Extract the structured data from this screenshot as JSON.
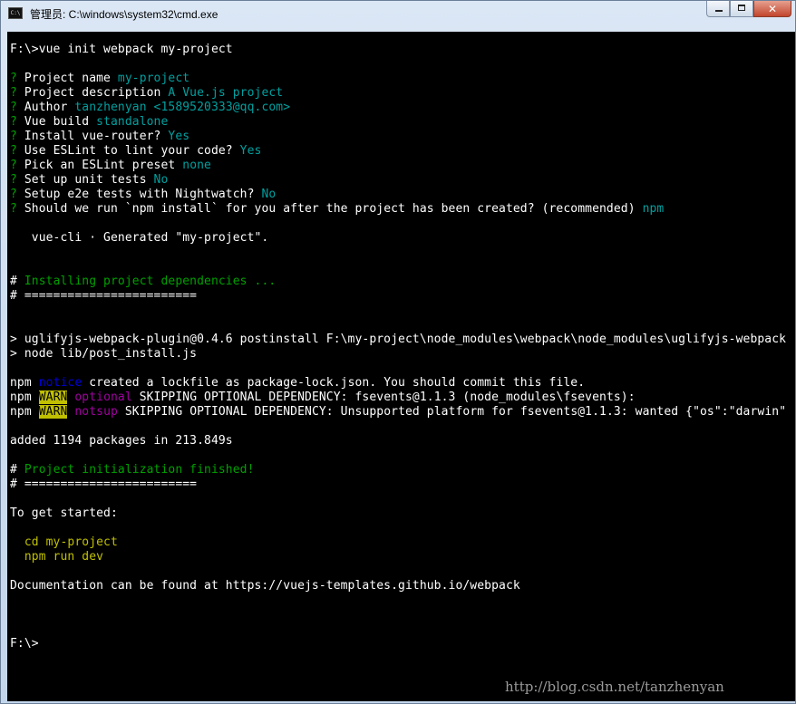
{
  "window": {
    "title": "管理员: C:\\windows\\system32\\cmd.exe",
    "icon": "cmd-icon",
    "controls": {
      "minimize": "minimize-icon",
      "maximize": "maximize-icon",
      "close": "close-icon",
      "close_glyph": "✕"
    }
  },
  "console": {
    "l1": "F:\\>vue init webpack my-project",
    "q": "?",
    "project_name_label": " Project name ",
    "project_name_value": "my-project",
    "project_desc_label": " Project description ",
    "project_desc_value": "A Vue.js project",
    "author_label": " Author ",
    "author_value": "tanzhenyan <1589520333@qq.com>",
    "vue_build_label": " Vue build ",
    "vue_build_value": "standalone",
    "router_label": " Install vue-router? ",
    "router_value": "Yes",
    "eslint_label": " Use ESLint to lint your code? ",
    "eslint_value": "Yes",
    "preset_label": " Pick an ESLint preset ",
    "preset_value": "none",
    "unit_label": " Set up unit tests ",
    "unit_value": "No",
    "e2e_label": " Setup e2e tests with Nightwatch? ",
    "e2e_value": "No",
    "npm_label": " Should we run `npm install` for you after the project has been created? (recommended) ",
    "npm_value": "npm",
    "generated": "   vue-cli · Generated \"my-project\".",
    "hash": "#",
    "installing": " Installing project dependencies ...",
    "rule": "# ========================",
    "postinstall": "> uglifyjs-webpack-plugin@0.4.6 postinstall F:\\my-project\\node_modules\\webpack\\node_modules\\uglifyjs-webpack",
    "node_cmd": "> node lib/post_install.js",
    "npm": "npm ",
    "notice": "notice",
    "notice_text": " created a lockfile as package-lock.json. You should commit this file.",
    "warn": "WARN",
    "optional": " optional",
    "optional_text": " SKIPPING OPTIONAL DEPENDENCY: fsevents@1.1.3 (node_modules\\fsevents):",
    "notsup": " notsup",
    "notsup_text": " SKIPPING OPTIONAL DEPENDENCY: Unsupported platform for fsevents@1.1.3: wanted {\"os\":\"darwin\"",
    "added": "added 1194 packages in 213.849s",
    "finished": " Project initialization finished!",
    "get_started": "To get started:",
    "cd": "  cd my-project",
    "run_dev": "  npm run dev",
    "docs": "Documentation can be found at https://vuejs-templates.github.io/webpack",
    "prompt": "F:\\>"
  },
  "watermark": "http://blog.csdn.net/tanzhenyan"
}
